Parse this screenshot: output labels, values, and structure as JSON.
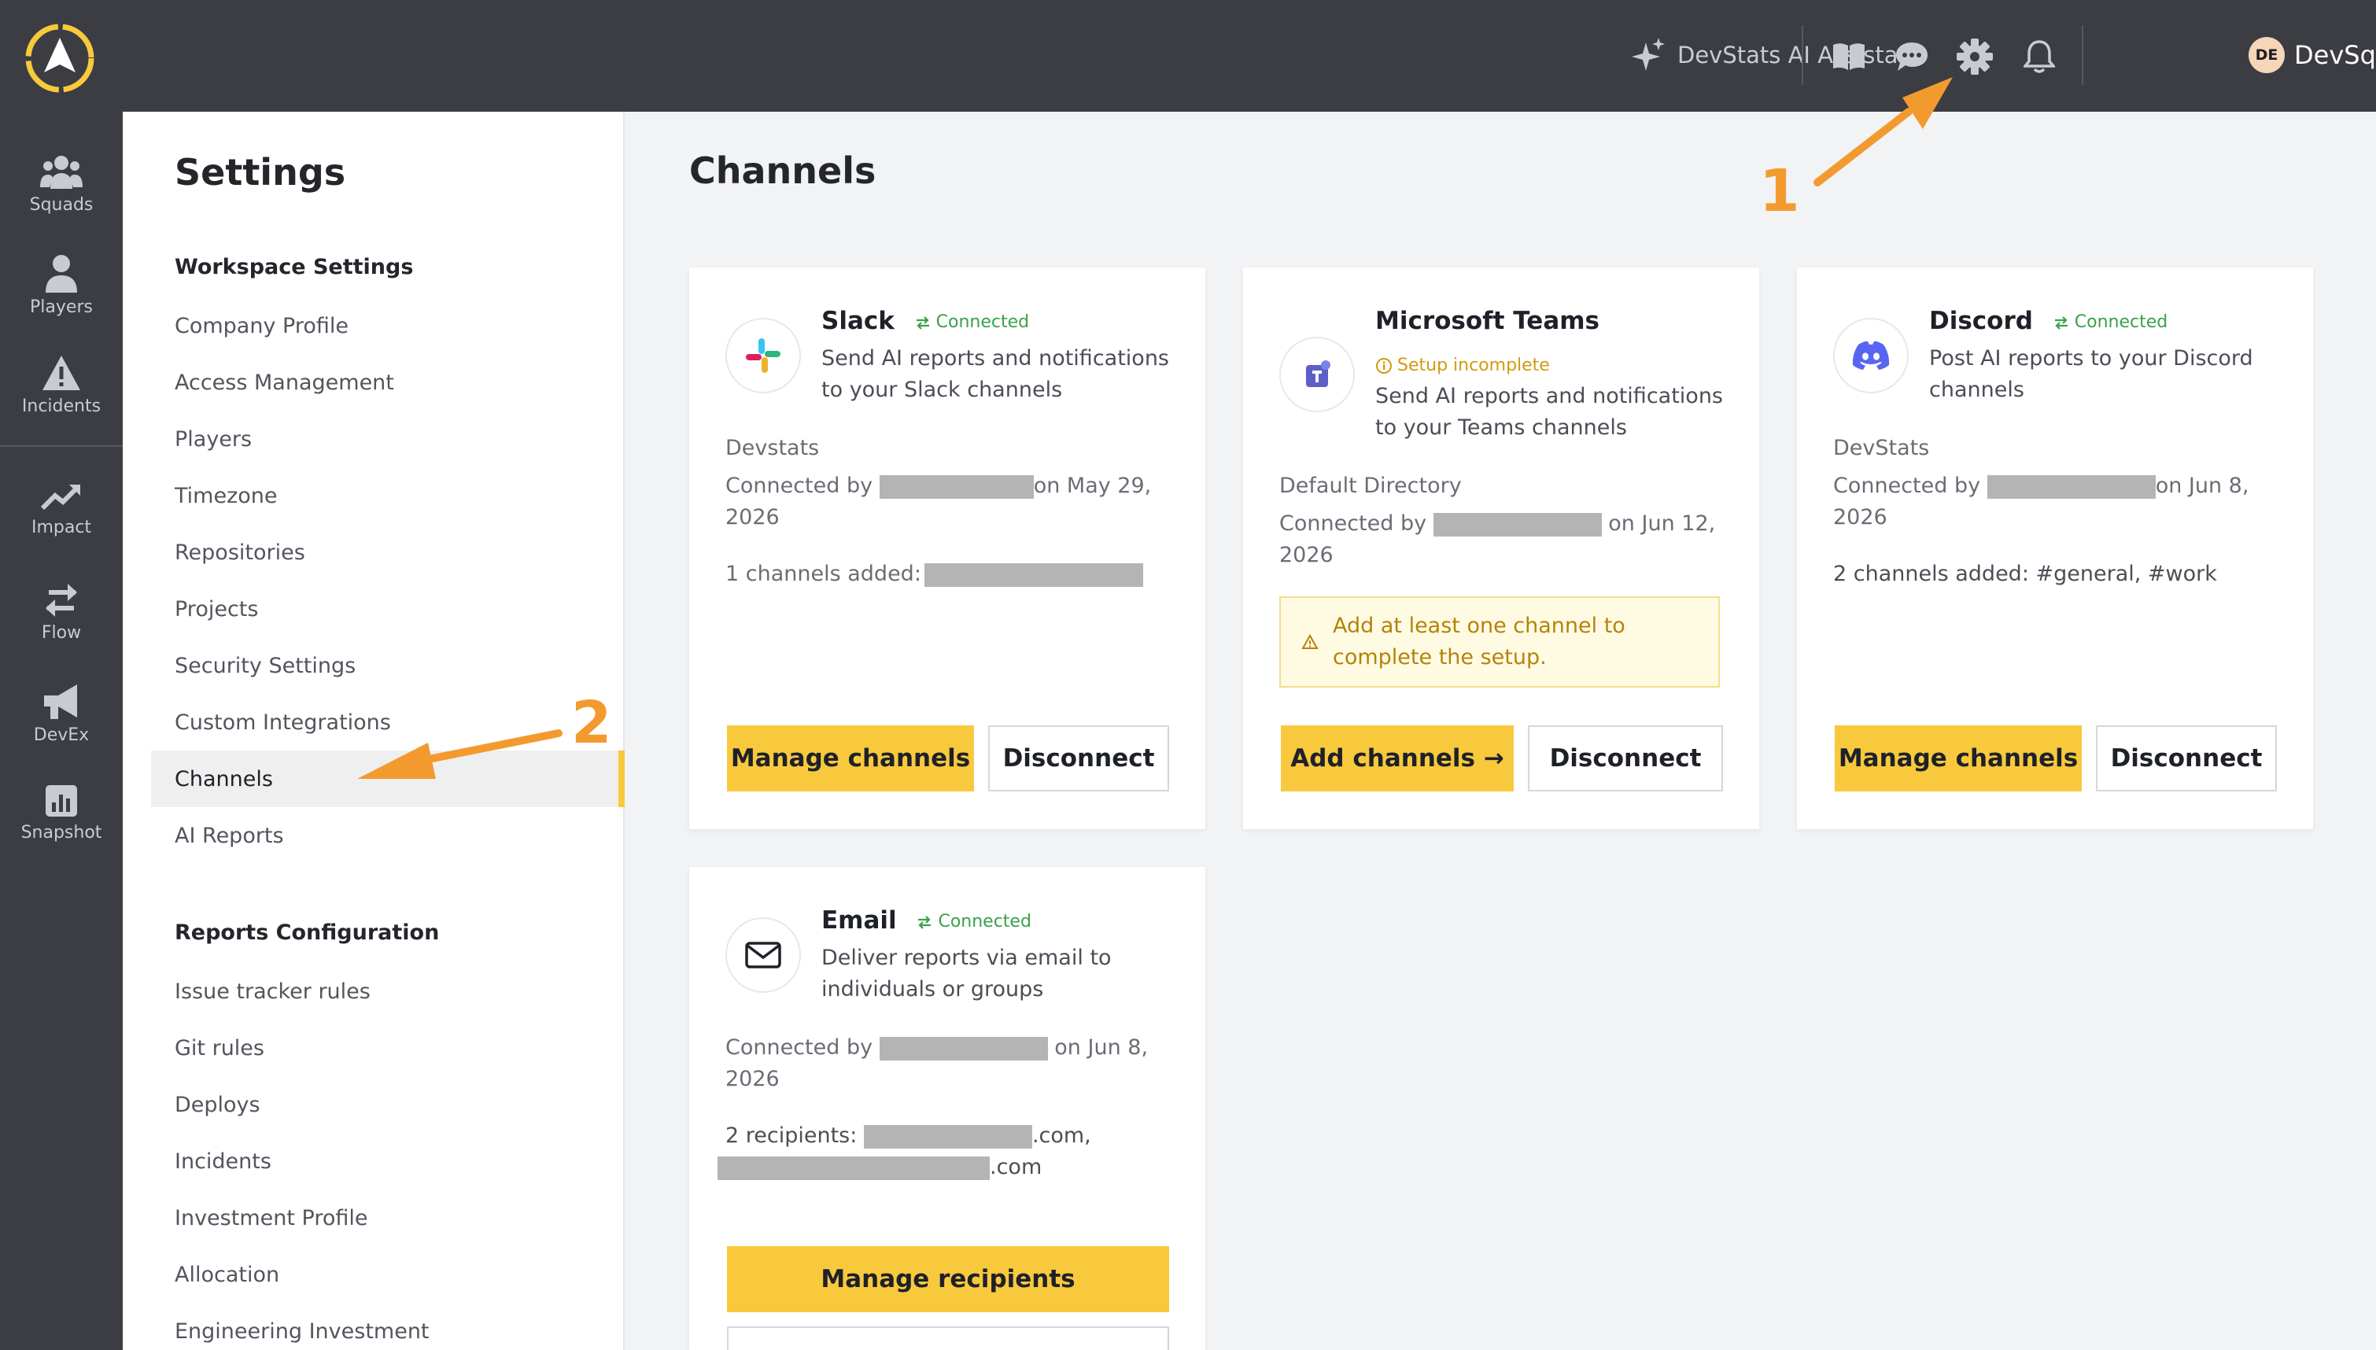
{
  "rail": {
    "items": [
      {
        "label": "Squads",
        "icon": "squads-icon"
      },
      {
        "label": "Players",
        "icon": "player-icon"
      },
      {
        "label": "Incidents",
        "icon": "warning-icon"
      },
      {
        "label": "Impact",
        "icon": "trend-up-icon"
      },
      {
        "label": "Flow",
        "icon": "arrows-swap-icon"
      },
      {
        "label": "DevEx",
        "icon": "megaphone-icon"
      },
      {
        "label": "Snapshot",
        "icon": "bar-chart-icon"
      }
    ]
  },
  "topbar": {
    "ai_assistant": "DevStats AI Assistant",
    "user_initials": "DE",
    "user_name": "DevSquad"
  },
  "settings": {
    "title": "Settings",
    "workspace_title": "Workspace Settings",
    "workspace_items": [
      "Company Profile",
      "Access Management",
      "Players",
      "Timezone",
      "Repositories",
      "Projects",
      "Security Settings",
      "Custom Integrations",
      "Channels",
      "AI Reports"
    ],
    "active_item": "Channels",
    "reports_title": "Reports Configuration",
    "reports_items": [
      "Issue tracker rules",
      "Git rules",
      "Deploys",
      "Incidents",
      "Investment Profile",
      "Allocation",
      "Engineering Investment"
    ]
  },
  "main": {
    "title": "Channels",
    "cards": {
      "slack": {
        "name": "Slack",
        "status": "Connected",
        "desc": "Send AI reports and notifications to your Slack channels",
        "workspace": "Devstats",
        "connected_prefix": "Connected by",
        "connected_suffix": "on May 29,",
        "connected_year": "2026",
        "channels_text": "1 channels added:",
        "primary": "Manage channels",
        "secondary": "Disconnect"
      },
      "teams": {
        "name": "Microsoft Teams",
        "status": "Setup incomplete",
        "desc": "Send AI reports and notifications to your Teams channels",
        "workspace": "Default Directory",
        "connected_prefix": "Connected by",
        "connected_suffix": "on Jun 12,",
        "connected_year": "2026",
        "alert": "Add at least one channel to complete the setup.",
        "primary": "Add channels →",
        "secondary": "Disconnect"
      },
      "discord": {
        "name": "Discord",
        "status": "Connected",
        "desc": "Post AI reports to your Discord channels",
        "workspace": "DevStats",
        "connected_prefix": "Connected by",
        "connected_suffix": "on Jun 8,",
        "connected_year": "2026",
        "channels_text": "2 channels added: #general, #work",
        "primary": "Manage channels",
        "secondary": "Disconnect"
      },
      "email": {
        "name": "Email",
        "status": "Connected",
        "desc": "Deliver reports via email to individuals or groups",
        "connected_prefix": "Connected by",
        "connected_suffix": "on Jun 8,",
        "connected_year": "2026",
        "recipients_prefix": "2 recipients:",
        "recipient1_suffix": ".com,",
        "recipient2_suffix": ".com",
        "primary": "Manage recipients"
      }
    }
  },
  "annotations": {
    "step1": "1",
    "step2": "2"
  },
  "colors": {
    "accent": "#f8c93d",
    "annotation": "#f39a2f",
    "connected": "#3aa14a",
    "warning": "#d39a12",
    "dark_bg": "#3b3d42"
  }
}
